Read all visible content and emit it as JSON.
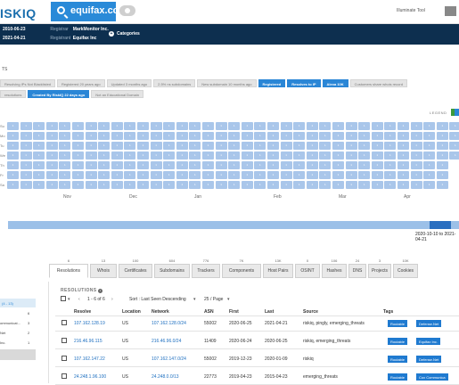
{
  "header": {
    "logo": "ISKIQ",
    "query": "equifax.com",
    "tools_label": "Illuminate Tool"
  },
  "info": {
    "row1": {
      "date": "2010-06-23",
      "label": "Registrar",
      "value": "MarkMonitor Inc."
    },
    "row2": {
      "date": "2021-04-21",
      "label": "Registrant",
      "value": "Equifax Inc"
    },
    "categories_label": "Categories"
  },
  "section_label": "TS",
  "tags_row1": [
    {
      "text": "Resolving IPs Not Blacklisted",
      "style": "gray"
    },
    {
      "text": "Registered 20 years ago",
      "style": "gray"
    },
    {
      "text": "Updated 3 months ago",
      "style": "gray"
    },
    {
      "text": "2.5% ns subdomains",
      "style": "gray"
    },
    {
      "text": "New subdomain 10 months ago",
      "style": "gray"
    },
    {
      "text": "Registered",
      "style": "blue"
    },
    {
      "text": "Resolves to IP",
      "style": "blue"
    },
    {
      "text": "Alexa 10K",
      "style": "blue"
    },
    {
      "text": "Customers share whois record",
      "style": "gray"
    }
  ],
  "tags_row2": [
    {
      "text": "resolutions",
      "style": "gray"
    },
    {
      "text": "Created By RiskIQ 22 days ago",
      "style": "blue"
    },
    {
      "text": "Not an Educational Domain",
      "style": "gray"
    }
  ],
  "legend_label": "LEGEND",
  "heatmap": {
    "day_labels": [
      "Su",
      "Mo",
      "Tu",
      "We",
      "Th",
      "Fr",
      "Sa"
    ],
    "cell_value": "1",
    "month_labels": [
      "Nov",
      "Dec",
      "Jan",
      "Feb",
      "Mar",
      "Apr"
    ]
  },
  "timeline": {
    "range": "2020-10-10 to 2021-04-21"
  },
  "tabs": [
    {
      "label": "Resolutions",
      "count": "6",
      "active": true
    },
    {
      "label": "Whois",
      "count": "13"
    },
    {
      "label": "Certificates",
      "count": "100"
    },
    {
      "label": "Subdomains",
      "count": "604"
    },
    {
      "label": "Trackers",
      "count": "776"
    },
    {
      "label": "Components",
      "count": "7K"
    },
    {
      "label": "Host Pairs",
      "count": "13K"
    },
    {
      "label": "OSINT",
      "count": "0"
    },
    {
      "label": "Hashes",
      "count": "106"
    },
    {
      "label": "DNS",
      "count": "24"
    },
    {
      "label": "Projects",
      "count": "3"
    },
    {
      "label": "Cookies",
      "count": "10K"
    }
  ],
  "left_panel": {
    "header": "(4 - 13)",
    "items": [
      {
        "label": "",
        "count": "6"
      },
      {
        "label": "ommunicat...",
        "count": "3"
      },
      {
        "label": "Net",
        "count": "2"
      },
      {
        "label": "Inc.",
        "count": "1"
      }
    ]
  },
  "resolutions": {
    "title": "RESOLUTIONS",
    "pagination": "1 - 6 of 6",
    "sort": "Sort : Last Seen Descending",
    "per_page": "25 / Page",
    "columns": [
      "Resolve",
      "Location",
      "Network",
      "ASN",
      "First",
      "Last",
      "Source",
      "Tags"
    ],
    "rows": [
      {
        "resolve": "107.162.128.19",
        "location": "US",
        "network": "107.162.128.0/24",
        "asn": "55002",
        "first": "2020-06-25",
        "last": "2021-04-21",
        "source": "riskiq, pingly, emerging_threats",
        "tags": [
          "Routable",
          "Defense.Net"
        ]
      },
      {
        "resolve": "216.46.96.115",
        "location": "US",
        "network": "216.46.96.0/24",
        "asn": "11409",
        "first": "2020-06-24",
        "last": "2020-06-25",
        "source": "riskiq, emerging_threats",
        "tags": [
          "Routable",
          "Equifax Inc."
        ]
      },
      {
        "resolve": "107.162.147.22",
        "location": "US",
        "network": "107.162.147.0/24",
        "asn": "55002",
        "first": "2019-12-23",
        "last": "2020-01-09",
        "source": "riskiq",
        "tags": [
          "Routable",
          "Defense.Net"
        ]
      },
      {
        "resolve": "24.248.1.96.100",
        "location": "US",
        "network": "24.248.0.0/13",
        "asn": "22773",
        "first": "2019-04-23",
        "last": "2015-04-23",
        "source": "emerging_threats",
        "tags": [
          "Routable",
          "Cox Communica"
        ]
      }
    ]
  }
}
